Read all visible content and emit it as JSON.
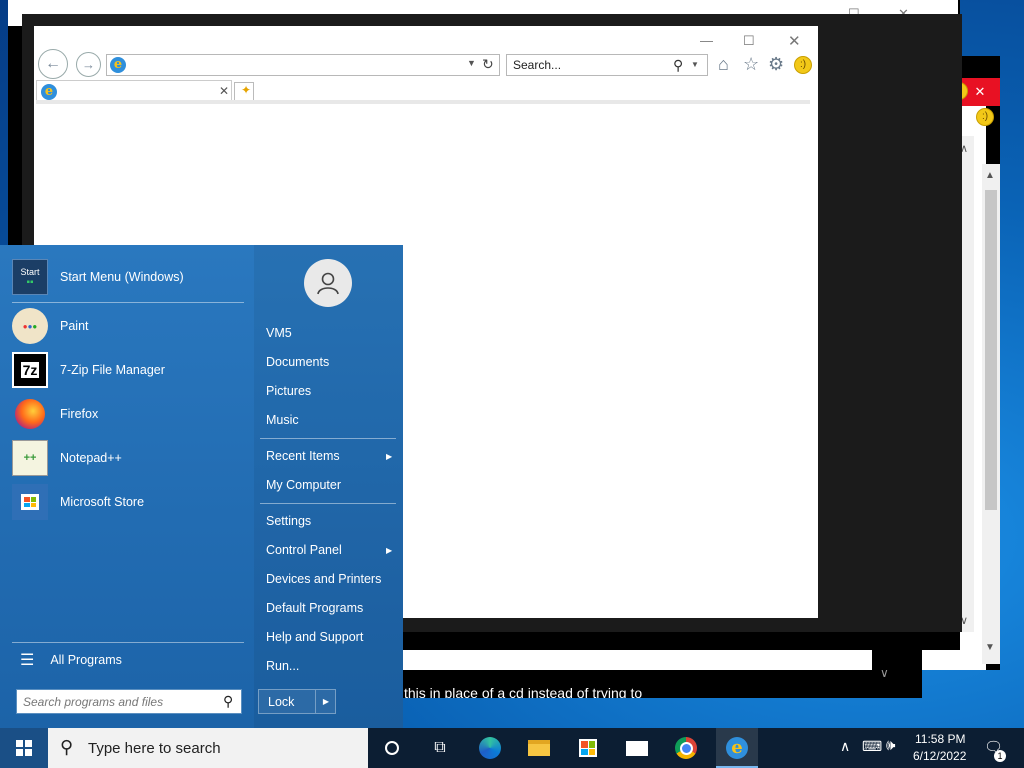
{
  "browser": {
    "search_placeholder": "Search...",
    "controls": {
      "minimize": "—",
      "maximize": "☐",
      "close": "✕"
    }
  },
  "background_text": "this in place of a cd instead of trying to",
  "start_menu": {
    "pinned": [
      {
        "label": "Start Menu (Windows)",
        "icon": "start-menu-icon",
        "icon_text": "Start"
      },
      {
        "label": "Paint",
        "icon": "paint-palette-icon"
      },
      {
        "label": "7-Zip File Manager",
        "icon": "7zip-icon",
        "icon_text": "7z"
      },
      {
        "label": "Firefox",
        "icon": "firefox-icon"
      },
      {
        "label": "Notepad++",
        "icon": "notepadpp-icon"
      },
      {
        "label": "Microsoft Store",
        "icon": "store-bag-icon"
      }
    ],
    "all_programs": "All Programs",
    "search_placeholder": "Search programs and files",
    "right_items": {
      "user": "VM5",
      "documents": "Documents",
      "pictures": "Pictures",
      "music": "Music",
      "recent": "Recent Items",
      "computer": "My Computer",
      "settings": "Settings",
      "control_panel": "Control Panel",
      "devices": "Devices and Printers",
      "default_programs": "Default Programs",
      "help": "Help and Support",
      "run": "Run..."
    },
    "lock": "Lock"
  },
  "taskbar": {
    "search_placeholder": "Type here to search",
    "time": "11:58 PM",
    "date": "6/12/2022",
    "notification_count": "1"
  },
  "colors": {
    "start_menu": "#1d68ae",
    "taskbar": "#0c1e33",
    "accent": "#0a63b6"
  }
}
